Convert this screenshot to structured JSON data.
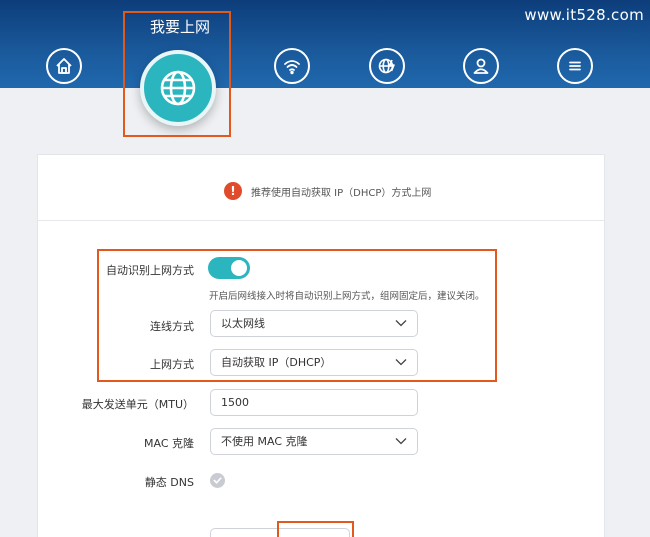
{
  "watermark": "www.it528.com",
  "nav": {
    "active_label": "我要上网",
    "icons": [
      "home-icon",
      "globe-icon",
      "wifi-icon",
      "network-settings-icon",
      "user-icon",
      "menu-icon"
    ]
  },
  "notice": {
    "icon": "!",
    "text": "推荐使用自动获取 IP（DHCP）方式上网"
  },
  "form": {
    "auto_detect_label": "自动识别上网方式",
    "auto_detect_on": true,
    "auto_detect_hint": "开启后网线接入时将自动识别上网方式，组网固定后，建议关闭。",
    "connection_label": "连线方式",
    "connection_value": "以太网线",
    "wan_label": "上网方式",
    "wan_value": "自动获取 IP（DHCP）",
    "mtu_label": "最大发送单元（MTU）",
    "mtu_value": "1500",
    "mac_label": "MAC 克隆",
    "mac_value": "不使用 MAC 克隆",
    "dns_label": "静态 DNS",
    "dns_checked": false
  },
  "colors": {
    "accent": "#2bb6bf",
    "highlight": "#e2581d",
    "header": "#1a5a9c",
    "warning": "#e04b2c"
  }
}
